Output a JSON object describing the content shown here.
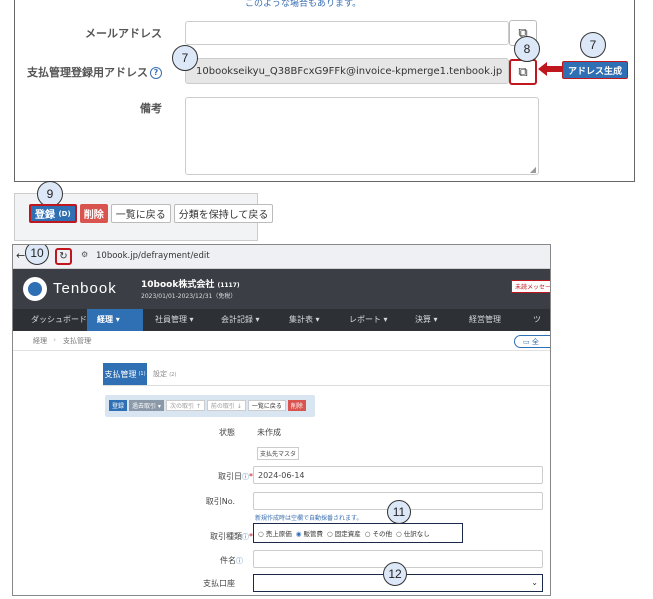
{
  "panel1": {
    "top_text": "このような場合もあります。",
    "email_label": "メールアドレス",
    "email_value": "",
    "payment_address_label": "支払管理登録用アドレス",
    "payment_address_value": "10bookseikyu_Q38BFcxG9FFk@invoice-kpmerge1.tenbook.jp",
    "notes_label": "備考",
    "notes_value": "",
    "generate_address_label": "アドレス生成",
    "markers": {
      "m7a": "7",
      "m8": "8",
      "m7b": "7"
    }
  },
  "panel2": {
    "marker": "9",
    "register_label": "登録",
    "register_shortcut": "(D)",
    "delete_label": "削除",
    "back_label": "一覧に戻る",
    "back_keep_label": "分類を保持して戻る"
  },
  "panel3": {
    "browser": {
      "url": "10book.jp/defrayment/edit",
      "marker": "10"
    },
    "app": {
      "logo_text": "Tenbook",
      "company_name": "10book株式会社",
      "company_code": "(1117)",
      "period": "2023/01/01-2023/12/31（免税）",
      "unread_badge": "未読メッセー"
    },
    "nav": [
      {
        "label": "ダッシュボード"
      },
      {
        "label": "経理 ▾"
      },
      {
        "label": "社員管理 ▾"
      },
      {
        "label": "会計記録 ▾"
      },
      {
        "label": "集計表 ▾"
      },
      {
        "label": "レポート ▾"
      },
      {
        "label": "決算 ▾"
      },
      {
        "label": "経営管理"
      },
      {
        "label": "ツ"
      }
    ],
    "breadcrumb": {
      "item1": "経理",
      "item2": "支払管理",
      "right_button": "全"
    },
    "tabs": {
      "active": "支払管理",
      "active_badge": "(1)",
      "inactive": "設定",
      "inactive_badge": "(2)"
    },
    "toolbar": {
      "register": "登録",
      "past_entries": "過去取引 ▾",
      "next_entry": "次の取引 ↑",
      "prev_entry": "前の取引 ↓",
      "back": "一覧に戻る",
      "delete": "削除"
    },
    "form": {
      "status_label": "状態",
      "status_value": "未作成",
      "payee_master_button": "支払先マスタ",
      "date_label": "取引日",
      "date_value": "2024-06-14",
      "number_label": "取引No.",
      "number_value": "",
      "number_hint": "新規作成時は空欄で自動採番されます。",
      "type_label": "取引種類",
      "types": [
        {
          "label": "売上原価",
          "checked": false
        },
        {
          "label": "販管費",
          "checked": true
        },
        {
          "label": "固定資産",
          "checked": false
        },
        {
          "label": "その他",
          "checked": false
        },
        {
          "label": "仕訳なし",
          "checked": false
        }
      ],
      "subject_label": "件名",
      "subject_value": "",
      "account_label": "支払口座",
      "account_value": ""
    },
    "markers": {
      "m11": "11",
      "m12": "12"
    }
  },
  "colors": {
    "accent_blue": "#2f6fb3",
    "marker_red": "#c0161d",
    "delete_red": "#d9534f",
    "dark_header": "#3b3f45",
    "nav_bg": "#2d3136",
    "marker_fill": "#dce8f7"
  }
}
